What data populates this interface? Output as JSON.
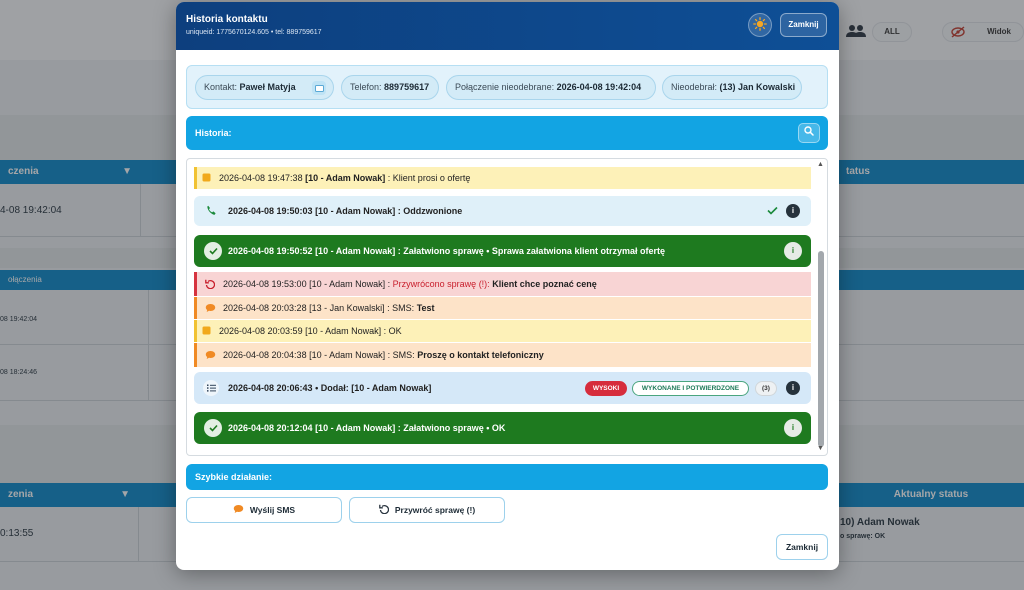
{
  "background": {
    "toolbar": {
      "all_label": "ALL",
      "view_label": "Widok"
    },
    "table1": {
      "header_col1": "czenia",
      "header_col2": "tatus",
      "row1_value": "4-08 19:42:04"
    },
    "table2": {
      "header_col1": "ołączenia",
      "rows": [
        "08 19:42:04",
        "08 18:24:46"
      ]
    },
    "table3": {
      "header_col1": "zenia",
      "header_status": "Aktualny status",
      "row1_value": "0:13:55",
      "row1_status": "10) Adam Nowak",
      "row1_status_sub": "o sprawę: OK"
    }
  },
  "modal": {
    "title": "Historia kontaktu",
    "subtitle": "uniqueid: 1775670124.605 • tel: 889759617",
    "close_top_label": "Zamknij",
    "info": {
      "contact_label": "Kontakt:",
      "contact_value": "Paweł Matyja",
      "phone_label": "Telefon:",
      "phone_value": "889759617",
      "missed_label": "Połączenie nieodebrane:",
      "missed_value": "2026-04-08 19:42:04",
      "not_answered_label": "Nieodebrał:",
      "not_answered_value": "(13) Jan Kowalski"
    },
    "history_label": "Historia:",
    "entries": [
      {
        "type": "note",
        "time": "2026-04-08 19:47:38",
        "who": "[10 - Adam Nowak]",
        "text": ": Klient prosi o ofertę"
      },
      {
        "type": "call",
        "text": "2026-04-08 19:50:03 [10 - Adam Nowak] : Oddzwonione"
      },
      {
        "type": "done",
        "text": "2026-04-08 19:50:52 [10 - Adam Nowak] : Załatwiono sprawę • Sprawa załatwiona klient otrzymał ofertę"
      },
      {
        "type": "restore",
        "time": "2026-04-08 19:53:00",
        "who": "[10 - Adam Nowak] :",
        "label": "Przywrócono sprawę (!):",
        "text": "Klient chce poznać cenę"
      },
      {
        "type": "sms",
        "time": "2026-04-08 20:03:28",
        "who": "[13 - Jan Kowalski]",
        "label": ": SMS:",
        "text": "Test"
      },
      {
        "type": "note",
        "time": "2026-04-08 20:03:59",
        "who": "[10 - Adam Nowak]",
        "text": ": OK"
      },
      {
        "type": "sms",
        "time": "2026-04-08 20:04:38",
        "who": "[10 - Adam Nowak]",
        "label": ": SMS:",
        "text": "Proszę o kontakt telefoniczny"
      },
      {
        "type": "task",
        "text": "2026-04-08 20:06:43 • Dodał: [10 - Adam Nowak]",
        "priority": "WYSOKI",
        "state": "WYKONANE I POTWIERDZONE",
        "count": "(3)"
      },
      {
        "type": "done",
        "text": "2026-04-08 20:12:04 [10 - Adam Nowak] : Załatwiono sprawę • OK"
      }
    ],
    "quick_label": "Szybkie działanie:",
    "send_sms_label": "Wyślij SMS",
    "restore_label": "Przywróć sprawę (!)",
    "close_bottom_label": "Zamknij"
  },
  "colors": {
    "header": "#0e4f96",
    "accent": "#12a4e3",
    "done": "#1e7a1f",
    "restore": "#d6333f",
    "sms": "#f08a24",
    "note": "#f1c232"
  }
}
